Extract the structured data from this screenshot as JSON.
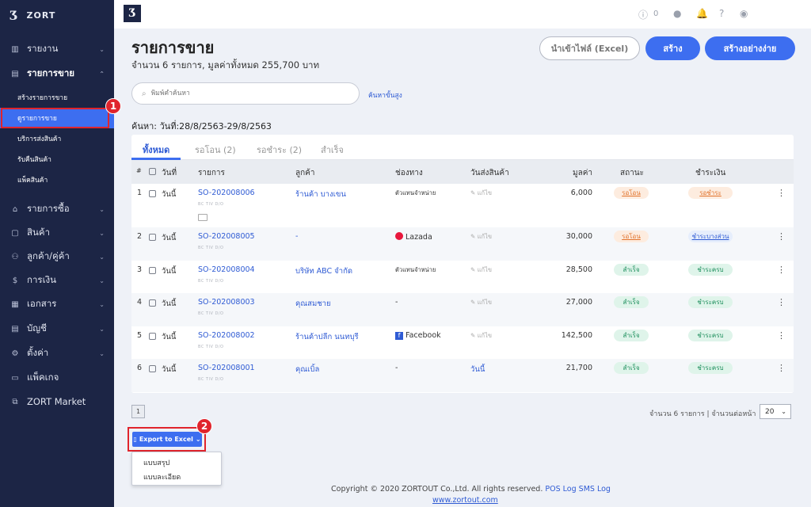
{
  "brand": "ZORT",
  "sidebar": {
    "items": [
      {
        "label": "รายงาน",
        "icon": "chart-icon"
      },
      {
        "label": "รายการขาย",
        "icon": "clipboard-icon"
      },
      {
        "label": "รายการซื้อ",
        "icon": "shop-icon"
      },
      {
        "label": "สินค้า",
        "icon": "box-icon"
      },
      {
        "label": "ลูกค้า/คู่ค้า",
        "icon": "users-icon"
      },
      {
        "label": "การเงิน",
        "icon": "dollar-icon"
      },
      {
        "label": "เอกสาร",
        "icon": "document-icon"
      },
      {
        "label": "บัญชี",
        "icon": "ledger-icon"
      },
      {
        "label": "ตั้งค่า",
        "icon": "gear-icon"
      },
      {
        "label": "แพ็คเกจ",
        "icon": "package-icon"
      },
      {
        "label": "ZORT Market",
        "icon": "market-icon"
      }
    ],
    "subitems": [
      "สร้างรายการขาย",
      "ดูรายการขาย",
      "บริการส่งสินค้า",
      "รับคืนสินค้า",
      "แพ็คสินค้า"
    ]
  },
  "topbar": {
    "count": "0"
  },
  "header": {
    "title": "รายการขาย",
    "summary": "จำนวน 6 รายการ, มูลค่าทั้งหมด 255,700 บาท"
  },
  "buttons": {
    "import": "นำเข้าไฟล์ (Excel)",
    "create": "สร้าง",
    "create_easy": "สร้างอย่างง่าย"
  },
  "search": {
    "placeholder": "พิมพ์คำค้นหา",
    "advanced": "ค้นหาขั้นสูง"
  },
  "criteria": "ค้นหา: วันที่:28/8/2563-29/8/2563",
  "tabs": [
    "ทั้งหมด",
    "รอโอน (2)",
    "รอชำระ (2)",
    "สำเร็จ"
  ],
  "columns": [
    "#",
    "วันที่",
    "รายการ",
    "ลูกค้า",
    "ช่องทาง",
    "วันส่งสินค้า",
    "มูลค่า",
    "สถานะ",
    "ชำระเงิน"
  ],
  "mini_labels": "BC TIV D/O",
  "rows": [
    {
      "no": "1",
      "date": "วันนี้",
      "id": "SO-202008006",
      "customer": "ร้านค้า บางเขน",
      "channel": "ตัวแทนจำหน่าย",
      "ship": "แก้ไข",
      "value": "6,000",
      "status": "รอโอน",
      "status_kind": "warn",
      "pay": "รอชำระ",
      "pay_kind": "warn"
    },
    {
      "no": "2",
      "date": "วันนี้",
      "id": "SO-202008005",
      "customer": "-",
      "channel": "Lazada",
      "ship": "แก้ไข",
      "value": "30,000",
      "status": "รอโอน",
      "status_kind": "warn",
      "pay": "ชำระบางส่วน",
      "pay_kind": "part"
    },
    {
      "no": "3",
      "date": "วันนี้",
      "id": "SO-202008004",
      "customer": "บริษัท ABC จำกัด",
      "channel": "ตัวแทนจำหน่าย",
      "ship": "แก้ไข",
      "value": "28,500",
      "status": "สำเร็จ",
      "status_kind": "ok",
      "pay": "ชำระครบ",
      "pay_kind": "ok"
    },
    {
      "no": "4",
      "date": "วันนี้",
      "id": "SO-202008003",
      "customer": "คุณสมชาย",
      "channel": "-",
      "ship": "แก้ไข",
      "value": "27,000",
      "status": "สำเร็จ",
      "status_kind": "ok",
      "pay": "ชำระครบ",
      "pay_kind": "ok"
    },
    {
      "no": "5",
      "date": "วันนี้",
      "id": "SO-202008002",
      "customer": "ร้านค้าปลีก นนทบุรี",
      "channel": "Facebook",
      "ship": "แก้ไข",
      "value": "142,500",
      "status": "สำเร็จ",
      "status_kind": "ok",
      "pay": "ชำระครบ",
      "pay_kind": "ok"
    },
    {
      "no": "6",
      "date": "วันนี้",
      "id": "SO-202008001",
      "customer": "คุณเบิ้ล",
      "channel": "-",
      "ship": "วันนี้",
      "value": "21,700",
      "status": "สำเร็จ",
      "status_kind": "ok",
      "pay": "ชำระครบ",
      "pay_kind": "ok"
    }
  ],
  "pagination": {
    "page": "1",
    "info": "จำนวน 6 รายการ | จำนวนต่อหน้า",
    "per_page": "20"
  },
  "export": {
    "label": "Export to Excel",
    "options": [
      "แบบสรุป",
      "แบบละเอียด"
    ]
  },
  "annotations": [
    "1",
    "2"
  ],
  "footer": {
    "text": "Copyright © 2020 ZORTOUT Co.,Ltd. All rights reserved.",
    "pos": "POS",
    "log": "Log",
    "sms": "SMS Log",
    "url": "www.zortout.com"
  },
  "colors": {
    "sidebar": "#1c2545",
    "accent": "#3d6ef0",
    "highlight": "#e0242c"
  }
}
